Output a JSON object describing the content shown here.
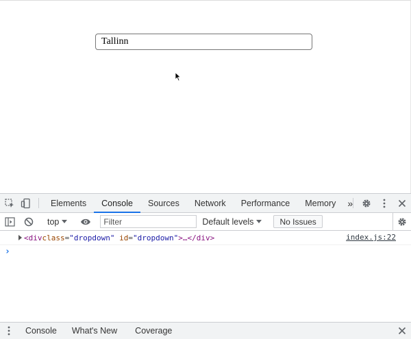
{
  "page": {
    "city_input_value": "Tallinn"
  },
  "devtools": {
    "tabs": [
      {
        "label": "Elements",
        "active": false
      },
      {
        "label": "Console",
        "active": true
      },
      {
        "label": "Sources",
        "active": false
      },
      {
        "label": "Network",
        "active": false
      },
      {
        "label": "Performance",
        "active": false
      },
      {
        "label": "Memory",
        "active": false
      }
    ],
    "more_tabs_glyph": "»",
    "toolbar": {
      "context": "top",
      "filter_placeholder": "Filter",
      "levels": "Default levels",
      "issues": "No Issues"
    },
    "console": {
      "log": {
        "open": "<div ",
        "attr1_name": "class",
        "attr1_value": "\"dropdown\"",
        "attr2_name": "id",
        "attr2_value": "\"dropdown\"",
        "mid": ">…</",
        "close": "div>",
        "eq": "=",
        "source": "index.js:22"
      },
      "prompt": "›"
    },
    "drawer": {
      "tabs": [
        "Console",
        "What's New",
        "Coverage"
      ]
    }
  },
  "colors": {
    "accent": "#1a73e8",
    "tag": "#881280",
    "attr_name": "#994500",
    "attr_value": "#1a1aa6"
  }
}
